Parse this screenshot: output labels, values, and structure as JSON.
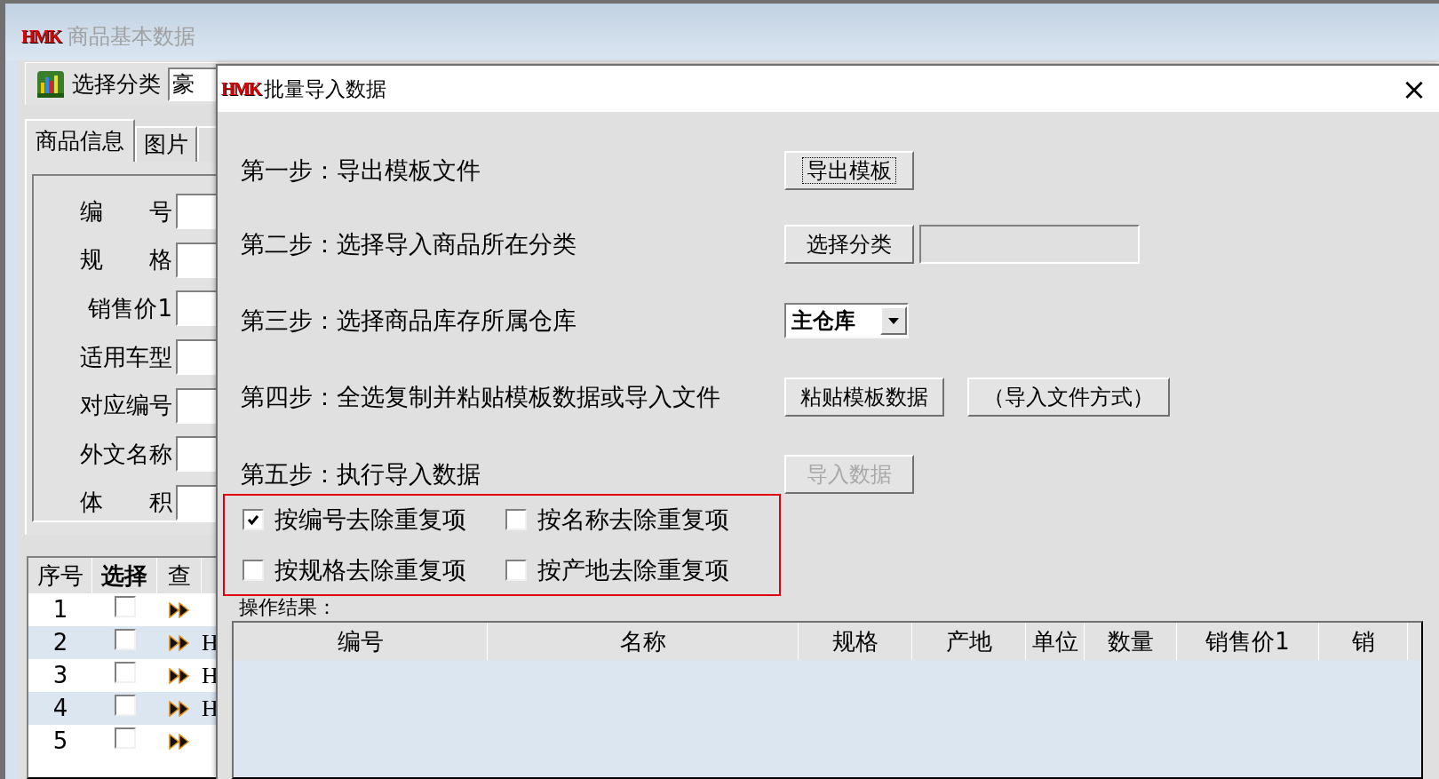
{
  "main_window": {
    "logo": "HMK",
    "title": "商品基本数据",
    "toolbar": {
      "button": "选择分类",
      "category_field": "豪"
    },
    "tabs": [
      {
        "label": "商品信息",
        "selected": true
      },
      {
        "label": "图片",
        "selected": false
      },
      {
        "selected": false
      }
    ],
    "fields": [
      {
        "label": "编　　号"
      },
      {
        "label": "规　　格"
      },
      {
        "label": "销售价1"
      },
      {
        "label": "适用车型"
      },
      {
        "label": "对应编号"
      },
      {
        "label": "外文名称"
      },
      {
        "label": "体　　积"
      }
    ],
    "grid": {
      "columns": [
        "序号",
        "选择",
        "查"
      ],
      "rows": [
        {
          "number": "1",
          "checked": false
        },
        {
          "number": "2",
          "checked": false,
          "column_4": "H"
        },
        {
          "number": "3",
          "checked": false,
          "column_4": "H"
        },
        {
          "number": "4",
          "checked": false,
          "column_4": "H"
        },
        {
          "number": "5",
          "checked": false
        }
      ]
    }
  },
  "dialog": {
    "logo": "HMK",
    "title": "批量导入数据",
    "close": "×",
    "steps": [
      {
        "label": "第一步：导出模板文件",
        "controls": [
          {
            "kind": "button",
            "text": "导出模板",
            "focused": true,
            "disabled": false
          }
        ]
      },
      {
        "label": "第二步：选择导入商品所在分类",
        "controls": [
          {
            "kind": "button",
            "text": "选择分类",
            "focused": false,
            "disabled": false
          },
          {
            "kind": "field"
          }
        ]
      },
      {
        "label": "第三步：选择商品库存所属仓库",
        "controls": [
          {
            "kind": "dropdown",
            "value": "主仓库"
          }
        ]
      },
      {
        "label": "第四步：全选复制并粘贴模板数据或导入文件",
        "controls": [
          {
            "kind": "button",
            "text": "粘贴模板数据",
            "focused": false,
            "disabled": false
          },
          {
            "kind": "button",
            "text": "（导入文件方式）",
            "focused": false,
            "disabled": false
          }
        ]
      },
      {
        "label": "第五步：执行导入数据",
        "controls": [
          {
            "kind": "button",
            "text": "导入数据",
            "focused": false,
            "disabled": true
          }
        ]
      }
    ],
    "dedupe_options": [
      {
        "label": "按编号去除重复项",
        "checked": true
      },
      {
        "label": "按名称去除重复项",
        "checked": false
      },
      {
        "label": "按规格去除重复项",
        "checked": false
      },
      {
        "label": "按产地去除重复项",
        "checked": false
      }
    ],
    "result_label": "操作结果：",
    "result_table": {
      "columns": [
        "编号",
        "名称",
        "规格",
        "产地",
        "单位",
        "数量",
        "销售价1",
        "销"
      ]
    }
  }
}
